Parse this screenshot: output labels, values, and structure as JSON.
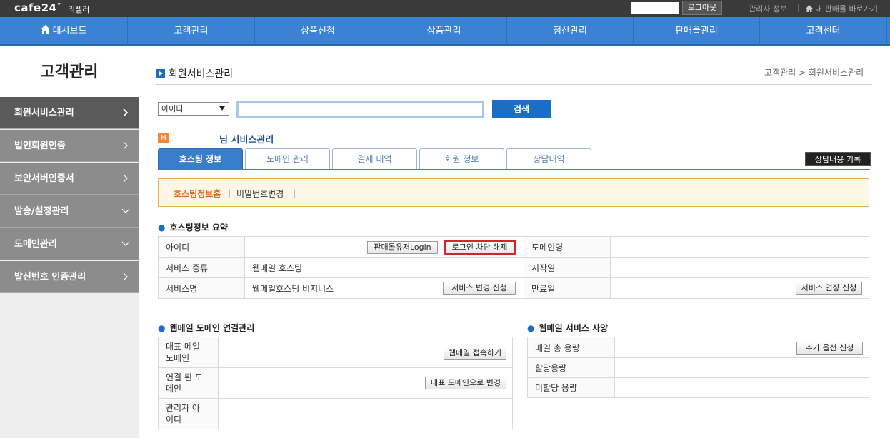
{
  "topbar": {
    "logo": "cafe24",
    "logo_tm": "™",
    "logo_sub": "리셀러",
    "logout": "로그아웃",
    "admin_info": "관리자 정보",
    "shop_link": "내 판매몰 바로가기"
  },
  "nav": {
    "items": [
      "대시보드",
      "고객관리",
      "상품신청",
      "상품관리",
      "정산관리",
      "판매몰관리",
      "고객센터"
    ]
  },
  "sidebar": {
    "title": "고객관리",
    "items": [
      "회원서비스관리",
      "법인회원인증",
      "보안서버인증서",
      "발송/설정관리",
      "도메인관리",
      "발신번호 인증관리"
    ]
  },
  "page": {
    "title": "회원서비스관리",
    "breadcrumb": "고객관리 > 회원서비스관리"
  },
  "search": {
    "select_value": "아이디",
    "input_value": "",
    "button": "검색"
  },
  "member": {
    "badge": "H",
    "title": "님 서비스관리"
  },
  "tabs": [
    "호스팅 정보",
    "도메인 관리",
    "결제 내역",
    "회원 정보",
    "상담내역"
  ],
  "consult_button": "상담내용 기록",
  "notice": {
    "link1": "호스팅정보홈",
    "link2": "비밀번호변경",
    "sep": "|"
  },
  "summary": {
    "title": "호스팅정보 요약",
    "rows": [
      {
        "label": "아이디",
        "value": "",
        "label2": "도메인명",
        "value2": ""
      },
      {
        "label": "서비스 종류",
        "value": "웹메일 호스팅",
        "label2": "시작일",
        "value2": ""
      },
      {
        "label": "서비스명",
        "value": "웹메일호스팅 비지니스",
        "label2": "만료일",
        "value2": ""
      }
    ],
    "btn_login": "판매몰유저Login",
    "btn_unblock": "로그인 차단 해제",
    "btn_change": "서비스 변경 신청",
    "btn_extend": "서비스 연장 신청"
  },
  "domain_mgmt": {
    "title": "웹메일 도메인 연결관리",
    "rows": [
      {
        "label_l1": "대표 메일",
        "label_l2": "도메인",
        "button": "웹메일 접속하기"
      },
      {
        "label_l1": "연결 된 도",
        "label_l2": "메인",
        "button": "대표 도메인으로 변경"
      },
      {
        "label_l1": "관리자 아",
        "label_l2": "이디",
        "button": ""
      }
    ]
  },
  "spec": {
    "title": "웹메일 서비스 사양",
    "rows": [
      {
        "label": "메일 총 용량",
        "button": "추가 옵션 신청"
      },
      {
        "label": "할당용량",
        "button": ""
      },
      {
        "label": "미할당 용량",
        "button": ""
      }
    ]
  }
}
